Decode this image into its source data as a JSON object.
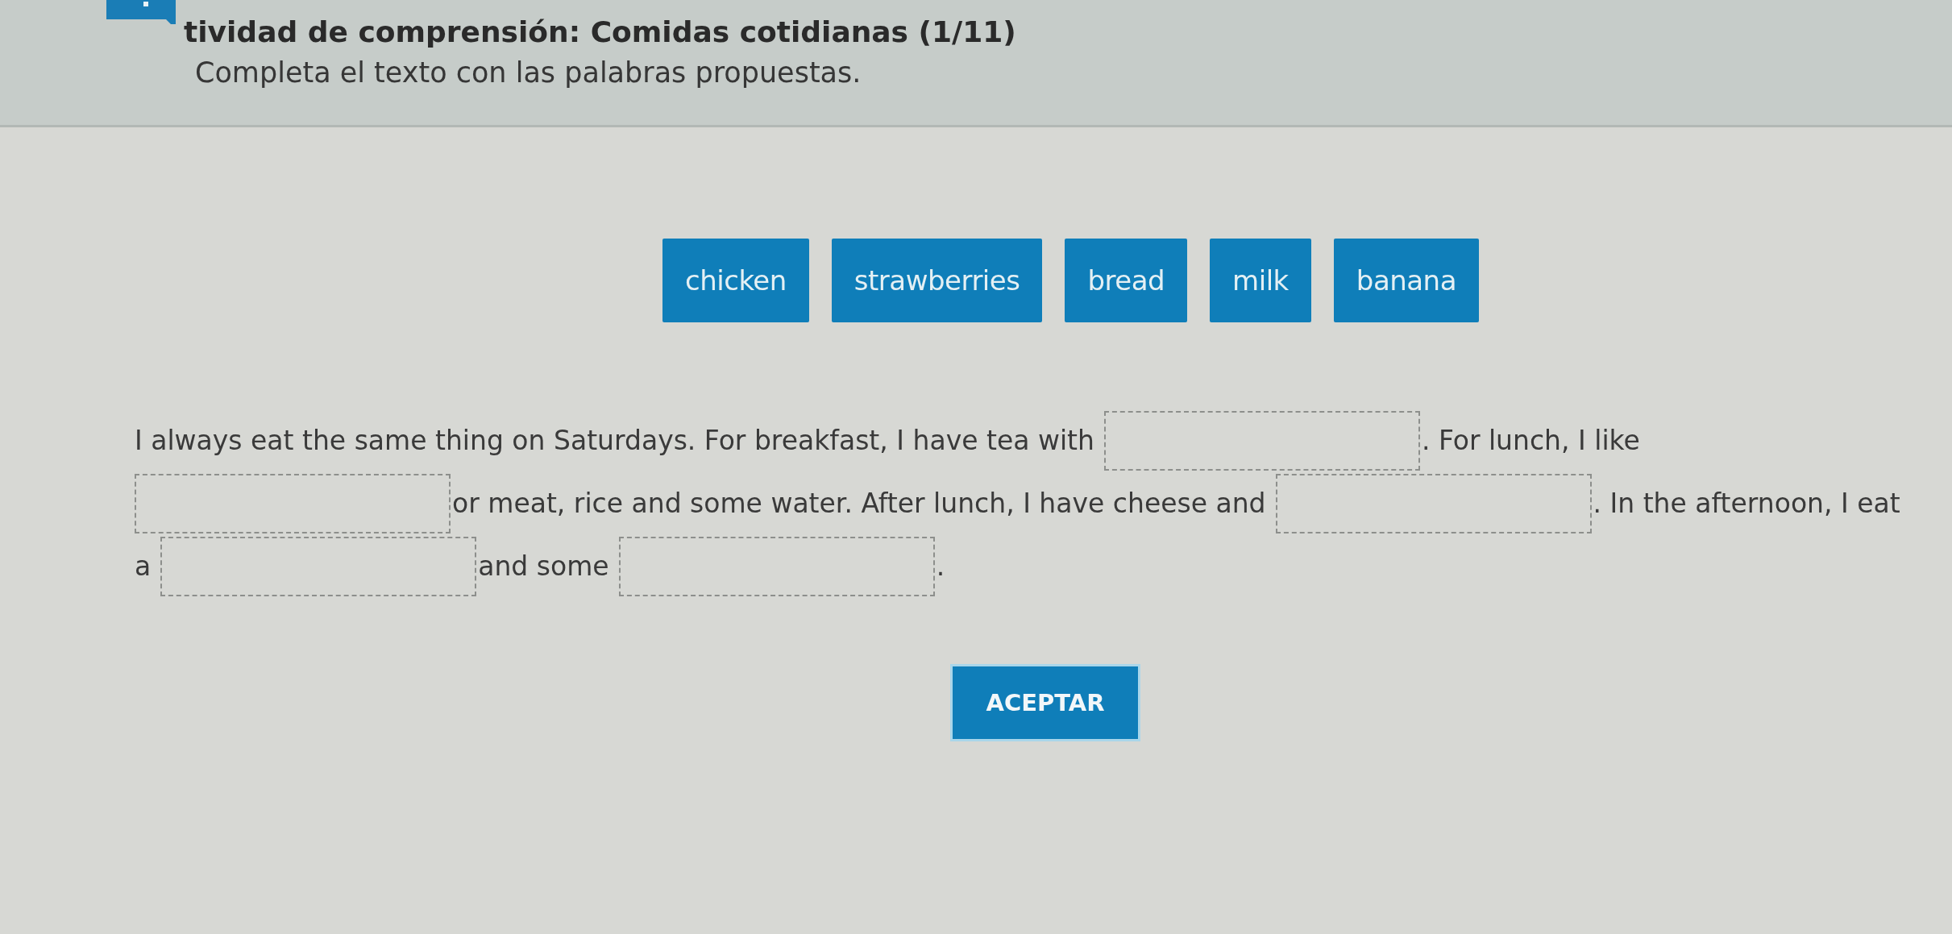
{
  "header": {
    "title": "tividad de comprensión: Comidas cotidianas (1/11)",
    "instruction": "Completa el texto con las palabras propuestas."
  },
  "word_bank": [
    "chicken",
    "strawberries",
    "bread",
    "milk",
    "banana"
  ],
  "passage": [
    {
      "kind": "text",
      "text": "I always eat the same thing on Saturdays. For breakfast, I have tea with"
    },
    {
      "kind": "blank"
    },
    {
      "kind": "text",
      "text": ". For lunch, I like"
    },
    {
      "kind": "blank"
    },
    {
      "kind": "text",
      "text": "or meat, rice and some water. After lunch, I have cheese and"
    },
    {
      "kind": "blank"
    },
    {
      "kind": "text",
      "text": ". In the afternoon, I eat"
    },
    {
      "kind": "text",
      "text": "a"
    },
    {
      "kind": "blank"
    },
    {
      "kind": "text",
      "text": "and some"
    },
    {
      "kind": "blank"
    },
    {
      "kind": "text",
      "text": "."
    }
  ],
  "buttons": [
    "ACEPTAR"
  ]
}
